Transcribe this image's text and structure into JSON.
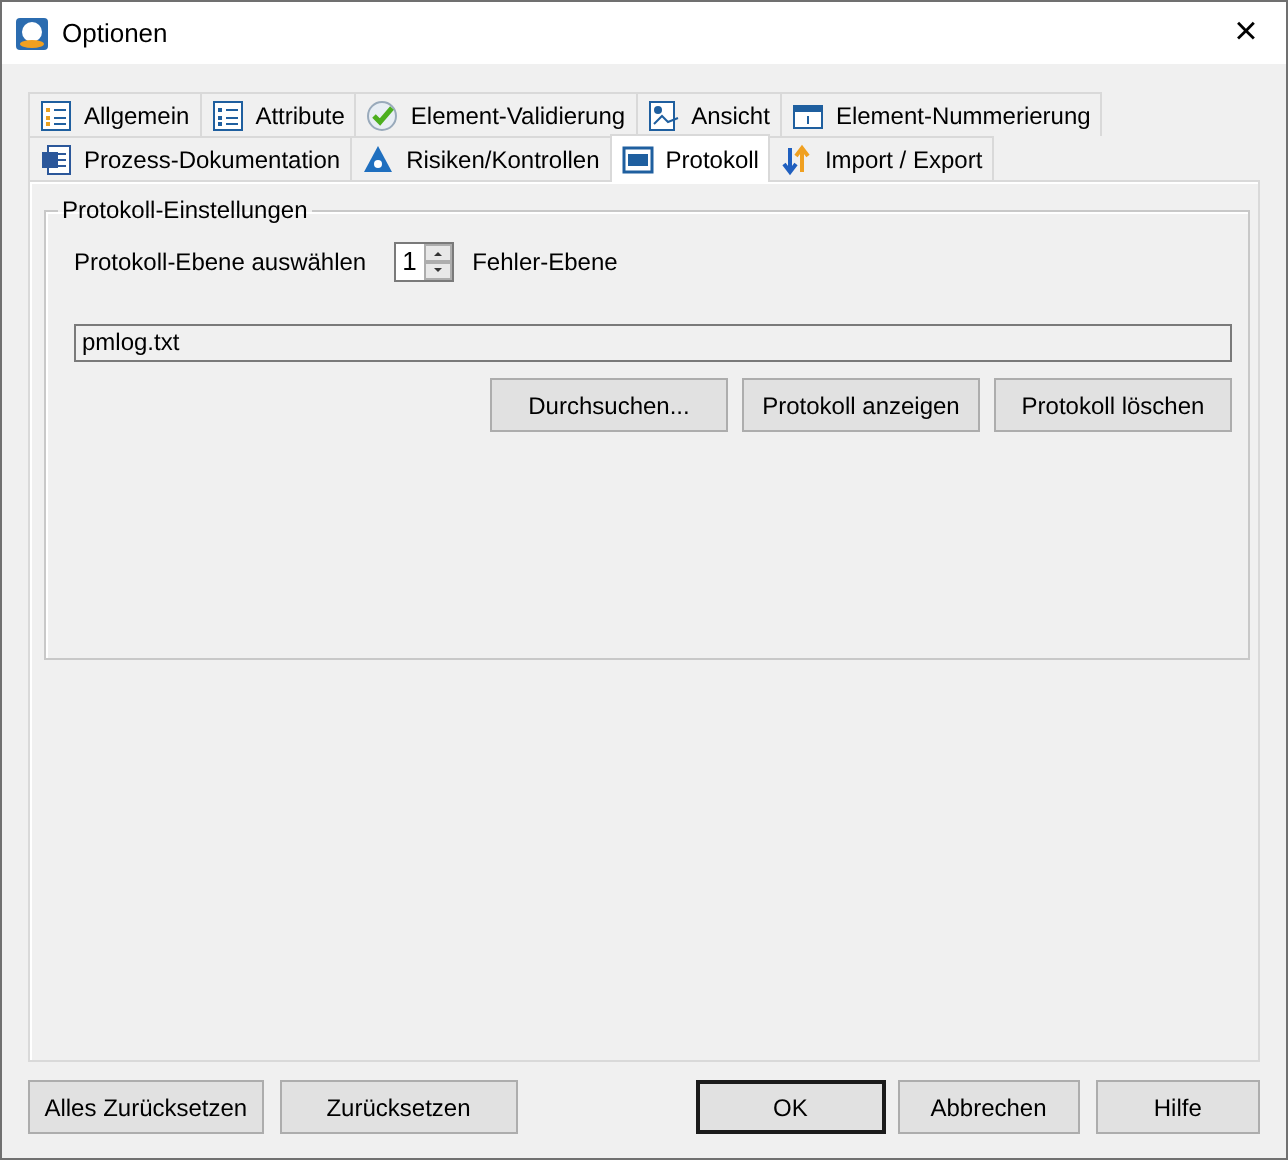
{
  "window": {
    "title": "Optionen",
    "close": "×"
  },
  "tab_rows": [
    [
      {
        "label": "Allgemein",
        "selected": false
      },
      {
        "label": "Attribute",
        "selected": false
      },
      {
        "label": "Element-Validierung",
        "selected": false
      },
      {
        "label": "Ansicht",
        "selected": false
      },
      {
        "label": "Element-Nummerierung",
        "selected": false
      }
    ],
    [
      {
        "label": "Prozess-Dokumentation",
        "selected": false
      },
      {
        "label": "Risiken/Kontrollen",
        "selected": false
      },
      {
        "label": "Protokoll",
        "selected": true
      },
      {
        "label": "Import / Export",
        "selected": false
      }
    ]
  ],
  "group": {
    "legend": "Protokoll-Einstellungen",
    "level_label": "Protokoll-Ebene auswählen",
    "level_value": "1",
    "level_text": "Fehler-Ebene",
    "file_field": {
      "value": "pmlog.txt"
    },
    "buttons": [
      "Durchsuchen...",
      "Protokoll anzeigen",
      "Protokoll löschen"
    ]
  },
  "footer_buttons": [
    {
      "label": "Alles Zurücksetzen",
      "default": false
    },
    {
      "label": "Zurücksetzen",
      "default": false
    },
    {
      "label": "OK",
      "default": true
    },
    {
      "label": "Abbrechen",
      "default": false
    },
    {
      "label": "Hilfe",
      "default": false
    }
  ]
}
